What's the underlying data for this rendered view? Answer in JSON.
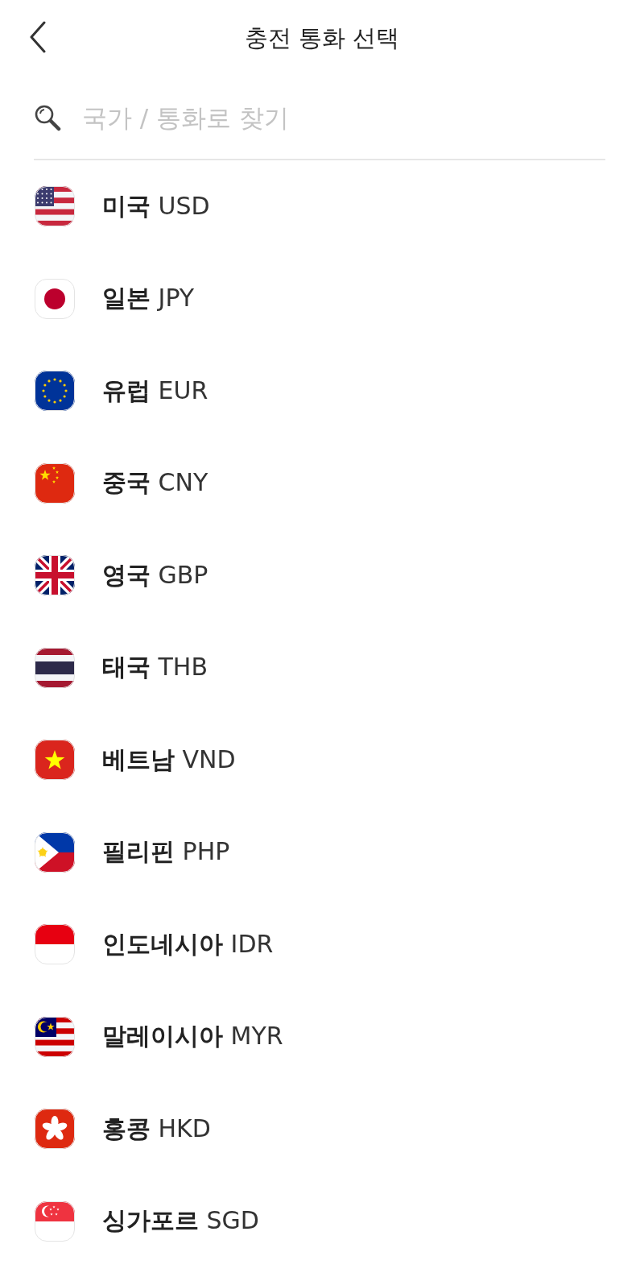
{
  "header": {
    "title": "충전 통화 선택"
  },
  "search": {
    "placeholder": "국가 / 통화로 찾기"
  },
  "currencies": [
    {
      "country": "미국",
      "code": "USD",
      "kind": "us"
    },
    {
      "country": "일본",
      "code": "JPY",
      "kind": "jp"
    },
    {
      "country": "유럽",
      "code": "EUR",
      "kind": "eu"
    },
    {
      "country": "중국",
      "code": "CNY",
      "kind": "cn"
    },
    {
      "country": "영국",
      "code": "GBP",
      "kind": "gb"
    },
    {
      "country": "태국",
      "code": "THB",
      "kind": "th"
    },
    {
      "country": "베트남",
      "code": "VND",
      "kind": "vn"
    },
    {
      "country": "필리핀",
      "code": "PHP",
      "kind": "ph"
    },
    {
      "country": "인도네시아",
      "code": "IDR",
      "kind": "id"
    },
    {
      "country": "말레이시아",
      "code": "MYR",
      "kind": "my"
    },
    {
      "country": "홍콩",
      "code": "HKD",
      "kind": "hk"
    },
    {
      "country": "싱가포르",
      "code": "SGD",
      "kind": "sg"
    }
  ]
}
